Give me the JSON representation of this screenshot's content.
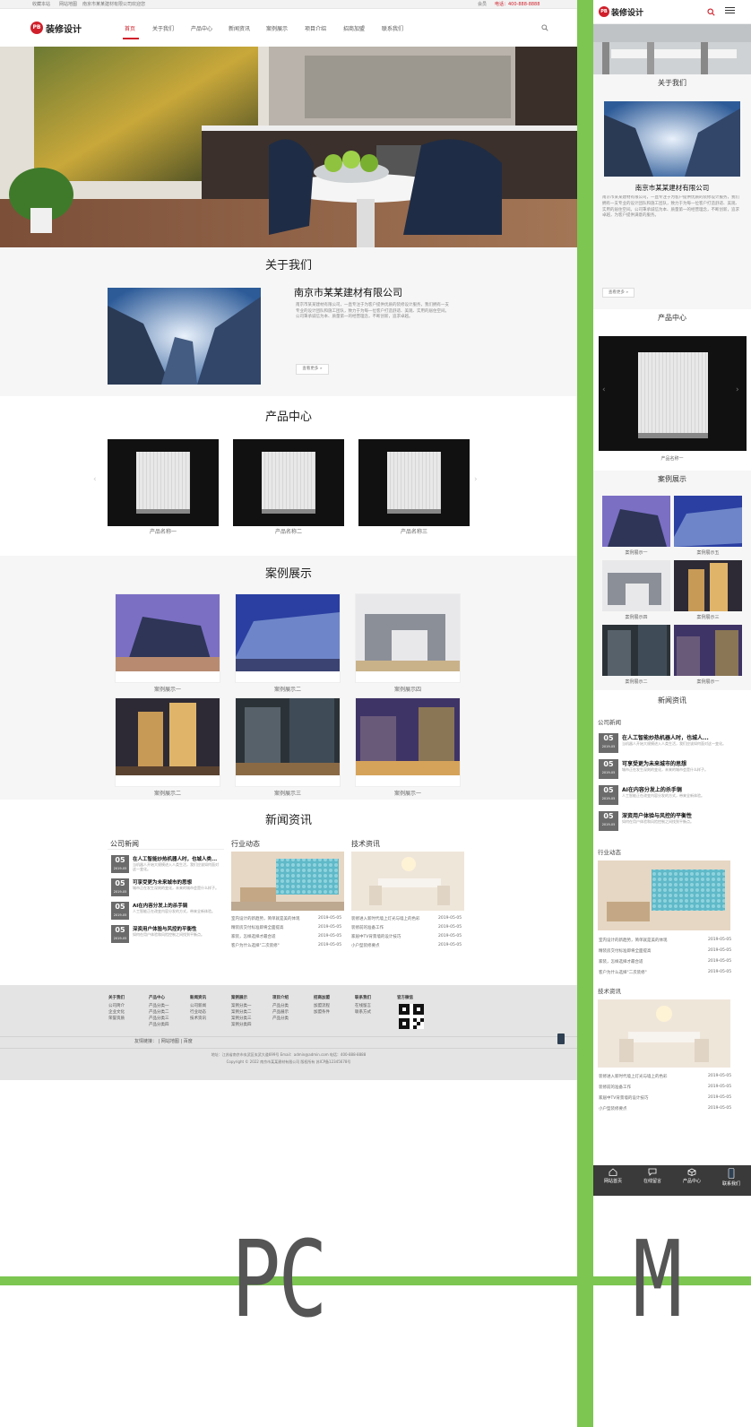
{
  "pc": {
    "topbar": {
      "left1": "收藏本站",
      "left2": "网站地图",
      "left3": "南京市某某建材有限公司欢迎您",
      "right1": "会员",
      "right2": "电话：400-888-8888"
    },
    "logo": {
      "badge": "PB",
      "text": "装修设计"
    },
    "nav": [
      "首页",
      "关于我们",
      "产品中心",
      "新闻资讯",
      "案例展示",
      "项目介绍",
      "招商加盟",
      "联系我们"
    ],
    "about": {
      "title": "关于我们",
      "company": "南京市某某建材有限公司",
      "desc": "南京市某某建材有限公司，一直专注于为客户提供优质的装修设计服务，我们拥有一支专业的设计团队和施工团队，致力于为每一位客户打造舒适、美观、实用的居住空间。公司秉承诚信为本、质量第一的经营理念，不断创新，追求卓越。",
      "more": "查看更多 »"
    },
    "products": {
      "title": "产品中心",
      "items": [
        "产品名称一",
        "产品名称二",
        "产品名称三"
      ]
    },
    "cases": {
      "title": "案例展示",
      "items": [
        "案例展示一",
        "案例展示二",
        "案例展示四",
        "案例展示二",
        "案例展示三",
        "案例展示一"
      ]
    },
    "news": {
      "title": "新闻资讯",
      "col1": {
        "head": "公司新闻",
        "items": [
          {
            "day": "05",
            "ym": "2019-05",
            "title": "在人工智能炒热机器人时，也城人类...",
            "desc": "当机器人开始大规模进入人类生活，我们应该如何面对这一变化。"
          },
          {
            "day": "05",
            "ym": "2019-05",
            "title": "可享受更为未来城市的思想",
            "desc": "城市正在发生深刻的变化，未来的城市会是什么样子。"
          },
          {
            "day": "05",
            "ym": "2019-05",
            "title": "AI在内容分发上的杀手锏",
            "desc": "人工智能正在改变内容分发的方式，带来全新体验。"
          },
          {
            "day": "05",
            "ym": "2019-05",
            "title": "深资用户体验与风控的平衡性",
            "desc": "如何在用户体验和风险控制之间找到平衡点。"
          }
        ]
      },
      "col2": {
        "head": "行业动态",
        "items": [
          {
            "t": "室内设计的新趋势，简单就是美的体现",
            "d": "2019-05-05"
          },
          {
            "t": "精装房交付标准即将全面提高",
            "d": "2019-05-05"
          },
          {
            "t": "家装，怎样选择才最合适",
            "d": "2019-05-05"
          },
          {
            "t": "客户为什么选择\"二次装修\"",
            "d": "2019-05-05"
          }
        ]
      },
      "col3": {
        "head": "技术资讯",
        "items": [
          {
            "t": "装修进入新时代墙上灯光与墙上的色彩",
            "d": "2019-05-05"
          },
          {
            "t": "装修前的准备工作",
            "d": "2019-05-05"
          },
          {
            "t": "家居中TV背景墙的设计技巧",
            "d": "2019-05-05"
          },
          {
            "t": "小户型装修要点",
            "d": "2019-05-05"
          }
        ]
      }
    },
    "footer": {
      "cols": [
        {
          "h": "关于我们",
          "items": [
            "公司简介",
            "企业文化",
            "荣誉资质"
          ]
        },
        {
          "h": "产品中心",
          "items": [
            "产品分类一",
            "产品分类二",
            "产品分类三",
            "产品分类四"
          ]
        },
        {
          "h": "新闻资讯",
          "items": [
            "公司新闻",
            "行业动态",
            "技术资讯"
          ]
        },
        {
          "h": "案例展示",
          "items": [
            "案例分类一",
            "案例分类二",
            "案例分类三",
            "案例分类四"
          ]
        },
        {
          "h": "项目介绍",
          "items": [
            "产品分类",
            "产品展示",
            "产品分类"
          ]
        },
        {
          "h": "招商加盟",
          "items": [
            "加盟流程",
            "加盟条件"
          ]
        },
        {
          "h": "联系我们",
          "items": [
            "在线留言",
            "联系方式"
          ]
        }
      ],
      "qr_label": "官方微信",
      "links": "友情链接：  |  网站地图  |  百度",
      "line1": "地址：江苏省南京市玄武区玄武大道699号  Email：admin@admin.com  电话：400-888-8888",
      "line2": "Copyright © 2022 南京市某某建材有限公司 版权所有 苏ICP备12345678号"
    }
  },
  "m": {
    "logo": {
      "badge": "PB",
      "text": "装修设计"
    },
    "about": {
      "title": "关于我们",
      "company": "南京市某某建材有限公司",
      "desc": "南京市某某建材有限公司，一直专注于为客户提供优质的装修设计服务，我们拥有一支专业的设计团队和施工团队，致力于为每一位客户打造舒适、美观、实用的居住空间。公司秉承诚信为本、质量第一的经营理念，不断创新，追求卓越，为客户提供满意的服务。",
      "more": "查看更多 »"
    },
    "products": {
      "title": "产品中心",
      "item": "产品名称一"
    },
    "cases": {
      "title": "案例展示",
      "items": [
        "案例展示一",
        "案例展示五",
        "案例展示四",
        "案例展示三",
        "案例展示二",
        "案例展示一"
      ]
    },
    "news": {
      "title": "新闻资讯",
      "col1_head": "公司新闻",
      "col1": [
        {
          "day": "05",
          "ym": "2019-05",
          "title": "在人工智能炒热机器人时，也城人...",
          "desc": "当机器人开始大规模进入人类生活，我们应该如何面对这一变化。"
        },
        {
          "day": "05",
          "ym": "2019-05",
          "title": "可享受更为未来城市的思想",
          "desc": "城市正在发生深刻的变化，未来的城市会是什么样子。"
        },
        {
          "day": "05",
          "ym": "2019-05",
          "title": "AI在内容分发上的杀手锏",
          "desc": "人工智能正在改变内容分发的方式，带来全新体验。"
        },
        {
          "day": "05",
          "ym": "2019-05",
          "title": "深资用户体验与风控的平衡性",
          "desc": "如何在用户体验和风险控制之间找到平衡点。"
        }
      ],
      "col2_head": "行业动态",
      "col2": [
        {
          "t": "室内设计的新趋势，简单就是美的体现",
          "d": "2019-05-05"
        },
        {
          "t": "精装房交付标准即将全面提高",
          "d": "2019-05-05"
        },
        {
          "t": "家装，怎样选择才最合适",
          "d": "2019-05-05"
        },
        {
          "t": "客户为什么选择\"二次装修\"",
          "d": "2019-05-05"
        }
      ],
      "col3_head": "技术资讯",
      "col3": [
        {
          "t": "装修进入新时代墙上灯光与墙上的色彩",
          "d": "2019-05-05"
        },
        {
          "t": "装修前的准备工作",
          "d": "2019-05-05"
        },
        {
          "t": "家居中TV背景墙的设计技巧",
          "d": "2019-05-05"
        },
        {
          "t": "小户型装修要点",
          "d": "2019-05-05"
        }
      ]
    },
    "tabs": [
      "网站首页",
      "在线留言",
      "产品中心",
      "联系我们"
    ]
  },
  "labels": {
    "pc": "PC",
    "m": "M"
  },
  "colors": {
    "accent": "#d0202b",
    "green": "#7cc651"
  }
}
